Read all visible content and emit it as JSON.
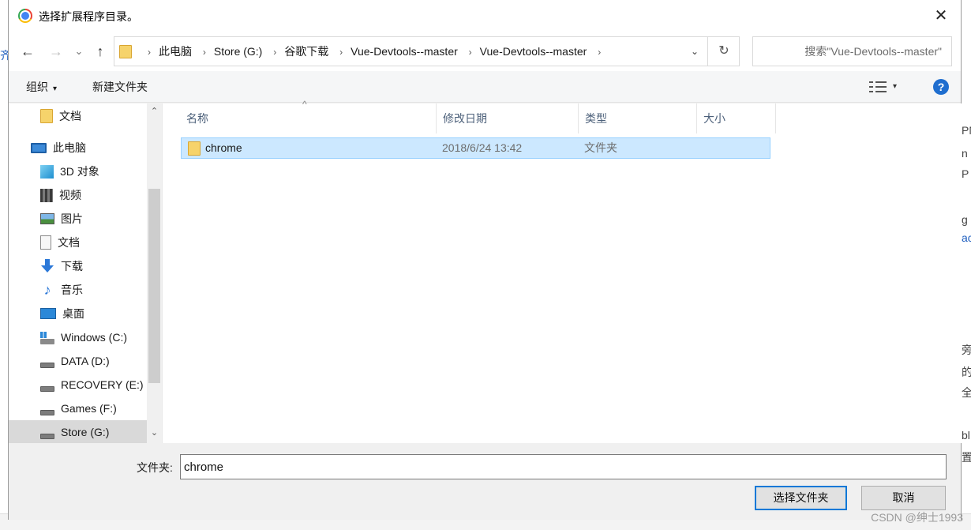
{
  "window": {
    "title": "选择扩展程序目录。",
    "close_glyph": "✕"
  },
  "nav": {
    "back_glyph": "←",
    "forward_glyph": "→",
    "recent_glyph": "⌄",
    "up_glyph": "↑",
    "breadcrumbs": [
      "此电脑",
      "Store (G:)",
      "谷歌下载",
      "Vue-Devtools--master",
      "Vue-Devtools--master"
    ],
    "separator": "›",
    "dropdown_glyph": "⌄",
    "refresh_glyph": "↻",
    "search_placeholder": "搜索\"Vue-Devtools--master\""
  },
  "toolbar": {
    "organize": "组织",
    "new_folder": "新建文件夹",
    "caret": "▾",
    "help": "?"
  },
  "sidebar": {
    "items": [
      {
        "label": "文档",
        "icon": "folder-icon"
      },
      {
        "label": "此电脑",
        "icon": "computer-icon"
      },
      {
        "label": "3D 对象",
        "icon": "3d-objects-icon"
      },
      {
        "label": "视频",
        "icon": "video-icon"
      },
      {
        "label": "图片",
        "icon": "pictures-icon"
      },
      {
        "label": "文档",
        "icon": "documents-icon"
      },
      {
        "label": "下载",
        "icon": "download-icon"
      },
      {
        "label": "音乐",
        "icon": "music-icon"
      },
      {
        "label": "桌面",
        "icon": "desktop-icon"
      },
      {
        "label": "Windows (C:)",
        "icon": "windows-drive-icon"
      },
      {
        "label": "DATA (D:)",
        "icon": "drive-icon"
      },
      {
        "label": "RECOVERY (E:)",
        "icon": "drive-icon"
      },
      {
        "label": "Games (F:)",
        "icon": "drive-icon"
      },
      {
        "label": "Store (G:)",
        "icon": "drive-icon",
        "selected": true
      }
    ],
    "scroll_up": "⌃",
    "scroll_down": "⌄"
  },
  "files": {
    "columns": [
      "名称",
      "修改日期",
      "类型",
      "大小"
    ],
    "sort_glyph": "^",
    "rows": [
      {
        "name": "chrome",
        "modified": "2018/6/24 13:42",
        "type": "文件夹",
        "size": ""
      }
    ]
  },
  "footer": {
    "folder_label": "文件夹:",
    "folder_value": "chrome",
    "select_button": "选择文件夹",
    "cancel_button": "取消"
  },
  "background": {
    "watermark": "CSDN @绅士1993",
    "left_fragment": "齐",
    "right_fragments": [
      "PN",
      "n",
      "P",
      "g",
      "ac",
      "旁",
      "的",
      "全",
      "bl",
      "置"
    ]
  },
  "colors": {
    "accent": "#0078d7",
    "selection": "#cce8ff",
    "selection_border": "#99d1ff",
    "folder": "#f6d36b",
    "help": "#1f6ecf"
  }
}
